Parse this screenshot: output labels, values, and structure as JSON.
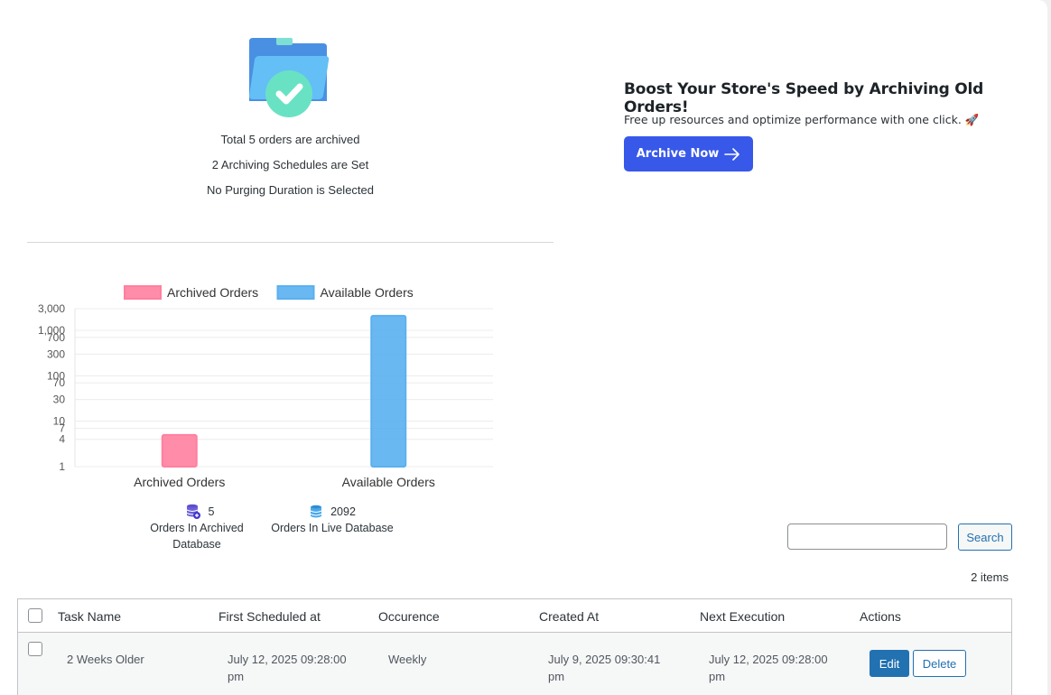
{
  "summary": {
    "total_archived": "Total 5 orders are archived",
    "schedules": "2 Archiving Schedules are Set",
    "purging": "No Purging Duration is Selected"
  },
  "promo": {
    "title": "Boost Your Store's Speed by Archiving Old Orders!",
    "text": "Free up resources and optimize performance with one click. 🚀",
    "button_label": "Archive Now"
  },
  "chart_data": {
    "type": "bar",
    "scale": "log",
    "categories": [
      "Archived Orders",
      "Available Orders"
    ],
    "series": [
      {
        "name": "Archived Orders",
        "color": "#ff809e",
        "values": [
          5,
          null
        ]
      },
      {
        "name": "Available Orders",
        "color": "#5ab0ef",
        "values": [
          null,
          2092
        ]
      }
    ],
    "yticks": [
      1,
      4,
      7,
      10,
      30,
      70,
      100,
      300,
      700,
      1000,
      3000
    ],
    "ytick_labels": [
      "1",
      "4",
      "7",
      "10",
      "30",
      "70",
      "100",
      "300",
      "700",
      "1,000",
      "3,000"
    ],
    "ylim": [
      1,
      3000
    ],
    "legend": "top",
    "grid": true
  },
  "db_stats": {
    "archived": {
      "value": "5",
      "label": "Orders In Archived Database"
    },
    "live": {
      "value": "2092",
      "label": "Orders In Live Database"
    }
  },
  "search": {
    "button_label": "Search",
    "placeholder": ""
  },
  "items_count": "2 items",
  "table": {
    "headers": [
      "Task Name",
      "First Scheduled at",
      "Occurence",
      "Created At",
      "Next Execution",
      "Actions"
    ],
    "rows": [
      {
        "task_name": "2 Weeks Older",
        "first_scheduled": "July 12, 2025 09:28:00 pm",
        "occurence": "Weekly",
        "created_at": "July 9, 2025 09:30:41 pm",
        "next_execution": "July 12, 2025 09:28:00 pm",
        "edit_label": "Edit",
        "delete_label": "Delete"
      }
    ]
  },
  "colors": {
    "primary": "#3858e9",
    "wp_blue": "#2271b1",
    "archived": "#ff809e",
    "available": "#5ab0ef",
    "check": "#69e2c4"
  }
}
